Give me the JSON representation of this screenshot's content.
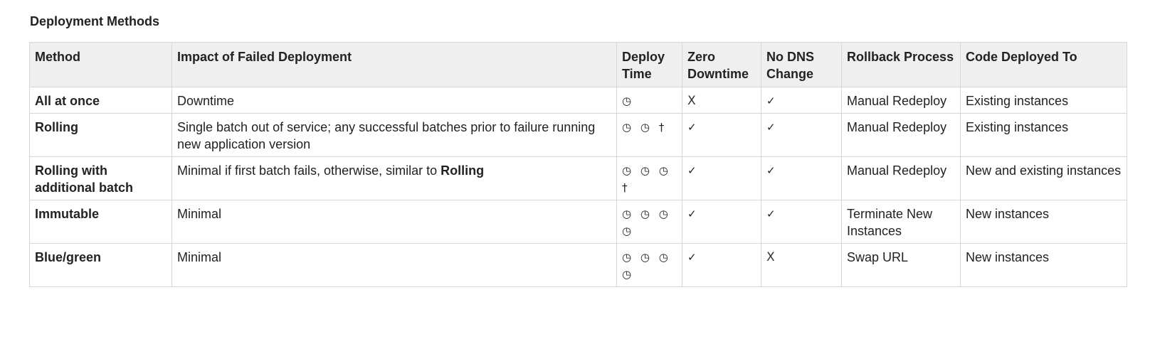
{
  "caption": "Deployment Methods",
  "headers": [
    "Method",
    "Impact of Failed Deployment",
    "Deploy Time",
    "Zero Downtime",
    "No DNS Change",
    "Rollback Process",
    "Code Deployed To"
  ],
  "symbols": {
    "clock_icon": "clock-icon",
    "check_icon": "check-icon",
    "cross_icon": "cross-icon",
    "dagger": "†"
  },
  "rows": [
    {
      "method": "All at once",
      "impact": "Downtime",
      "impact_emphasis": "",
      "deploy_time": "◷",
      "zero_downtime": "X",
      "no_dns_change": "✓",
      "rollback": "Manual Redeploy",
      "deployed_to": "Existing instances"
    },
    {
      "method": "Rolling",
      "impact": "Single batch out of service; any successful batches prior to failure running new application version",
      "impact_emphasis": "",
      "deploy_time": "◷ ◷ †",
      "zero_downtime": "✓",
      "no_dns_change": "✓",
      "rollback": "Manual Redeploy",
      "deployed_to": "Existing instances"
    },
    {
      "method": "Rolling with additional batch",
      "impact": "Minimal if first batch fails, otherwise, similar to ",
      "impact_emphasis": "Rolling",
      "deploy_time": "◷ ◷ ◷ †",
      "zero_downtime": "✓",
      "no_dns_change": "✓",
      "rollback": "Manual Redeploy",
      "deployed_to": "New and existing instances"
    },
    {
      "method": "Immutable",
      "impact": "Minimal",
      "impact_emphasis": "",
      "deploy_time": "◷ ◷ ◷ ◷",
      "zero_downtime": "✓",
      "no_dns_change": "✓",
      "rollback": "Terminate New Instances",
      "deployed_to": "New instances"
    },
    {
      "method": "Blue/green",
      "impact": "Minimal",
      "impact_emphasis": "",
      "deploy_time": "◷ ◷ ◷ ◷",
      "zero_downtime": "✓",
      "no_dns_change": "X",
      "rollback": "Swap URL",
      "deployed_to": "New instances"
    }
  ]
}
